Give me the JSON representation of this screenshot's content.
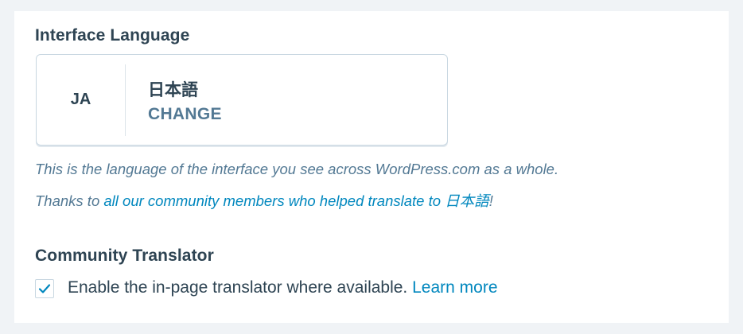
{
  "interface_language": {
    "title": "Interface Language",
    "picker": {
      "code": "JA",
      "name": "日本語",
      "change_label": "CHANGE"
    },
    "description": "This is the language of the interface you see across WordPress.com as a whole.",
    "thanks": {
      "prefix": "Thanks to ",
      "link_text": "all our community members who helped translate to ",
      "link_lang": "日本語",
      "suffix": "!"
    }
  },
  "community_translator": {
    "title": "Community Translator",
    "checkbox": {
      "checked": true,
      "label": "Enable the in-page translator where available. ",
      "learn_more": "Learn more"
    }
  },
  "colors": {
    "page_background": "#f0f3f6",
    "card_background": "#ffffff",
    "heading_text": "#2e4453",
    "muted_text": "#537994",
    "link": "#0087be",
    "border": "#c8d7e1"
  },
  "icons": {
    "checkbox_check": "checkmark-icon"
  }
}
